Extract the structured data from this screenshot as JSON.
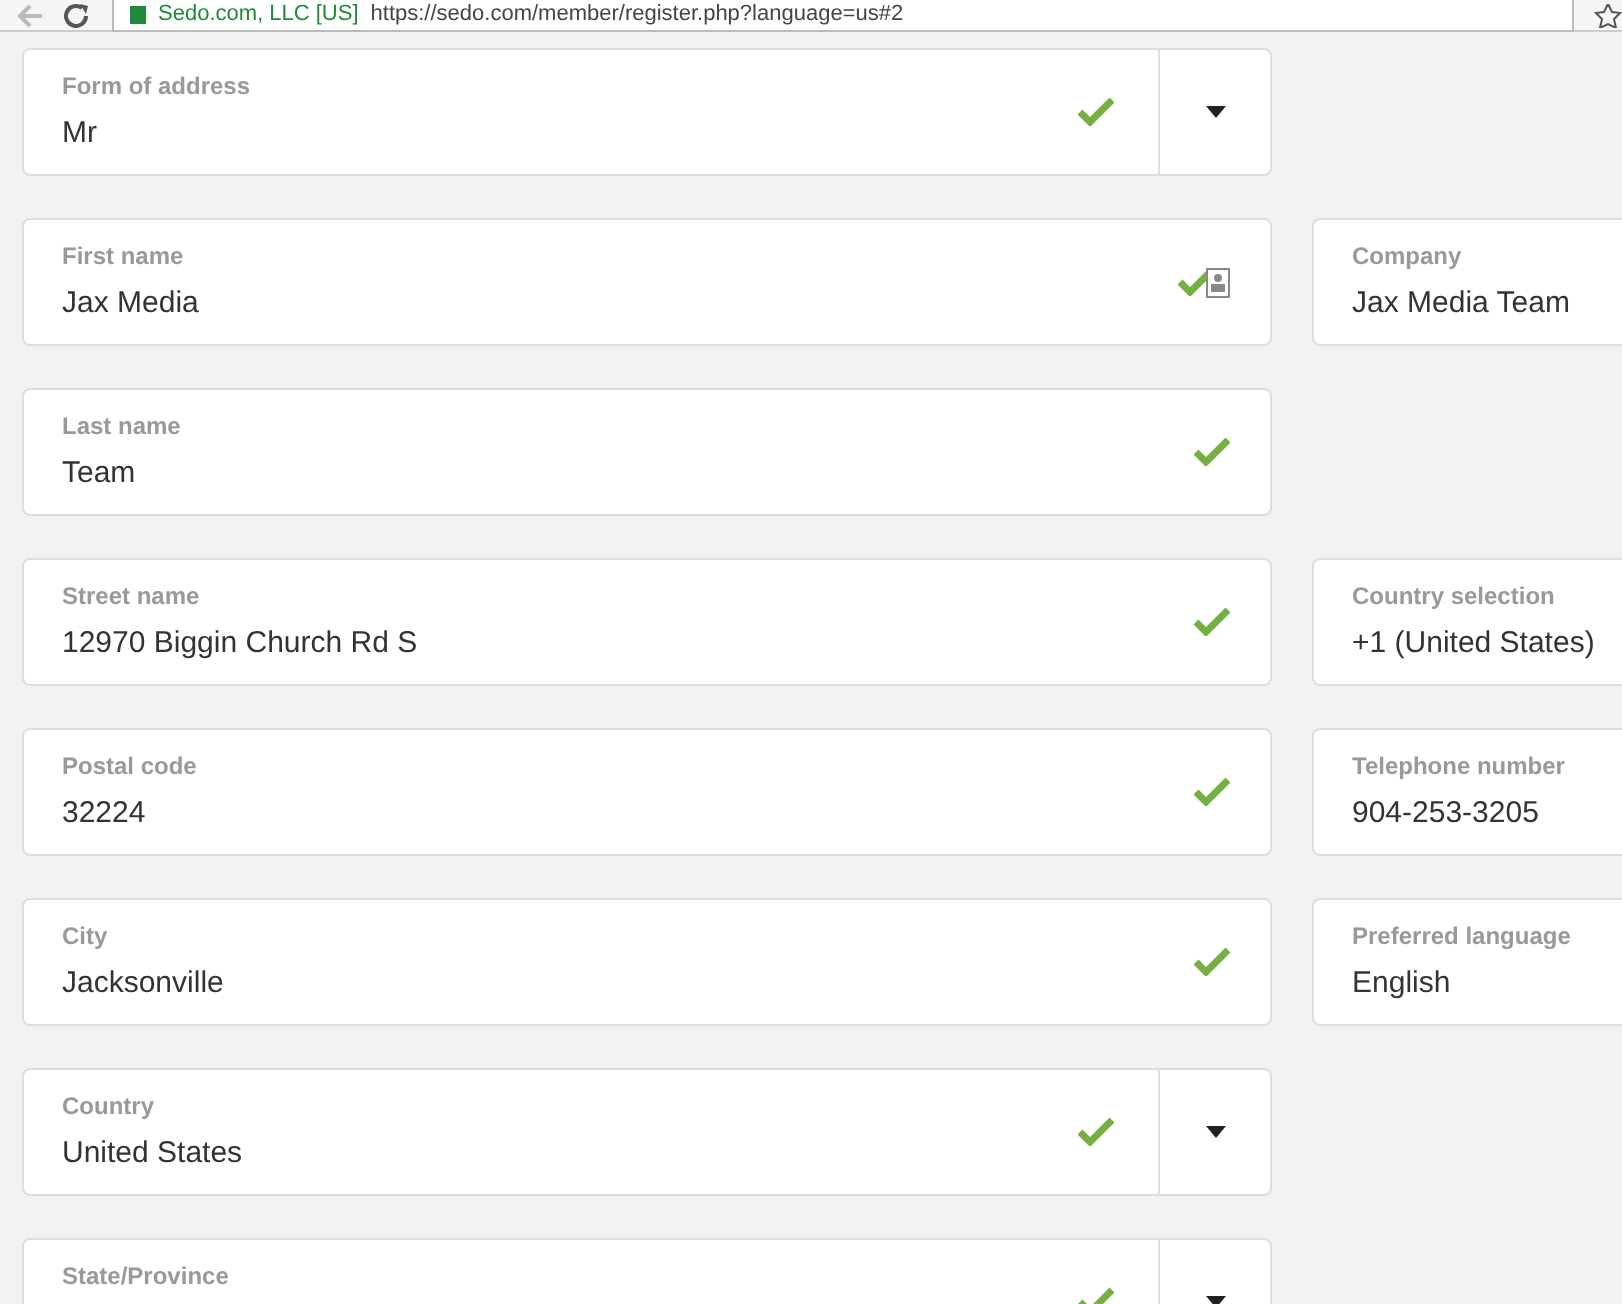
{
  "browser": {
    "site_name": "Sedo.com, LLC [US]",
    "url": "https://sedo.com/member/register.php?language=us#2"
  },
  "rows": [
    {
      "left": {
        "kind": "select",
        "label": "Form of address",
        "value": "Mr",
        "valid": true,
        "autofill": false
      }
    },
    {
      "left": {
        "kind": "text",
        "label": "First name",
        "value": "Jax Media",
        "valid": true,
        "autofill": true
      },
      "right": {
        "label": "Company",
        "value": "Jax Media Team"
      }
    },
    {
      "left": {
        "kind": "text",
        "label": "Last name",
        "value": "Team",
        "valid": true,
        "autofill": false
      }
    },
    {
      "left": {
        "kind": "text",
        "label": "Street name",
        "value": "12970 Biggin Church Rd S",
        "valid": true,
        "autofill": false
      },
      "right": {
        "label": "Country selection",
        "value": "+1 (United States)"
      }
    },
    {
      "left": {
        "kind": "text",
        "label": "Postal code",
        "value": "32224",
        "valid": true,
        "autofill": false
      },
      "right": {
        "label": "Telephone number",
        "value": "904-253-3205"
      }
    },
    {
      "left": {
        "kind": "text",
        "label": "City",
        "value": "Jacksonville",
        "valid": true,
        "autofill": false
      },
      "right": {
        "label": "Preferred language",
        "value": "English"
      }
    },
    {
      "left": {
        "kind": "select",
        "label": "Country",
        "value": "United States",
        "valid": true,
        "autofill": false
      }
    },
    {
      "left": {
        "kind": "select",
        "label": "State/Province",
        "valid": true,
        "autofill": false
      }
    }
  ]
}
